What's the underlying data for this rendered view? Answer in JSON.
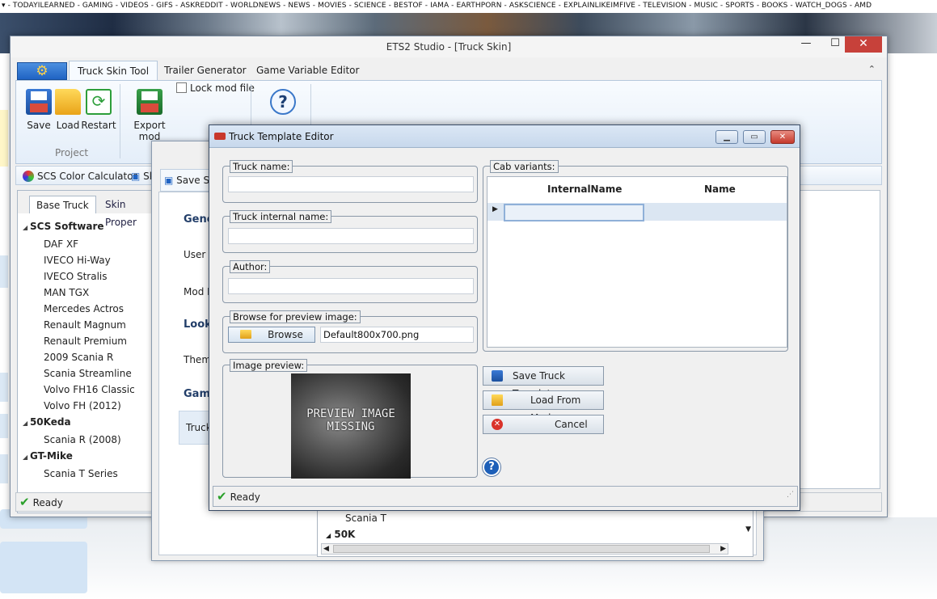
{
  "browser": {
    "nav_strip": "▾ - TODAYILEARNED - GAMING - VIDEOS - GIFS - ASKREDDIT - WORLDNEWS - NEWS - MOVIES - SCIENCE - BESTOF - IAMA - EARTHPORN - ASKSCIENCE - EXPLAINLIKEIMFIVE - TELEVISION - MUSIC - SPORTS - BOOKS - WATCH_DOGS - AMD"
  },
  "main_window": {
    "title": "ETS2 Studio - [Truck Skin]",
    "minimize": "—",
    "maximize": "☐",
    "close": "✕",
    "tabs": [
      "Truck Skin Tool",
      "Trailer Generator",
      "Game Variable Editor"
    ],
    "ribbon": {
      "save": "Save",
      "load": "Load",
      "restart": "Restart",
      "group_project": "Project",
      "export": "Export mod",
      "lock_mod": "Lock mod file"
    },
    "toolbar": {
      "color_calc": "SCS Color Calculator",
      "second": "Sk"
    },
    "left_tabs": [
      "Base Truck",
      "Skin Proper"
    ],
    "tree": [
      {
        "group": "SCS Software",
        "items": [
          "DAF XF",
          "IVECO Hi-Way",
          "IVECO Stralis",
          "MAN TGX",
          "Mercedes Actros",
          "Renault Magnum",
          "Renault Premium",
          "2009 Scania R",
          "Scania Streamline",
          "Volvo FH16 Classic",
          "Volvo FH (2012)"
        ]
      },
      {
        "group": "50Keda",
        "items": [
          "Scania R (2008)"
        ]
      },
      {
        "group": "GT-Mike",
        "items": [
          "Scania T Series"
        ]
      }
    ],
    "status": "Ready"
  },
  "middle_window": {
    "save_btn": "Save S",
    "headings": [
      "Gene",
      "Look",
      "Game"
    ],
    "labels": [
      "User Ir",
      "Mod B",
      "Theme"
    ],
    "selected": "Truck",
    "list_item": "Scania T",
    "list_group": "50K"
  },
  "editor": {
    "title": "Truck Template Editor",
    "truck_name_label": "Truck name:",
    "truck_name_value": "",
    "internal_label": "Truck internal name:",
    "internal_value": "",
    "author_label": "Author:",
    "author_value": "",
    "browse_label": "Browse for preview image:",
    "browse_btn": "Browse",
    "browse_value": "Default800x700.png",
    "preview_label": "Image preview:",
    "preview_text": "PREVIEW IMAGE\nMISSING",
    "cab_label": "Cab variants:",
    "grid_columns": [
      "InternalName",
      "Name"
    ],
    "save_template": "Save Truck Template",
    "load_mod": "Load From Mod",
    "cancel": "Cancel",
    "status": "Ready"
  },
  "colors": {
    "accent": "#1f63c3",
    "close_red": "#c7413a",
    "ready_check": "#2aa02a"
  }
}
